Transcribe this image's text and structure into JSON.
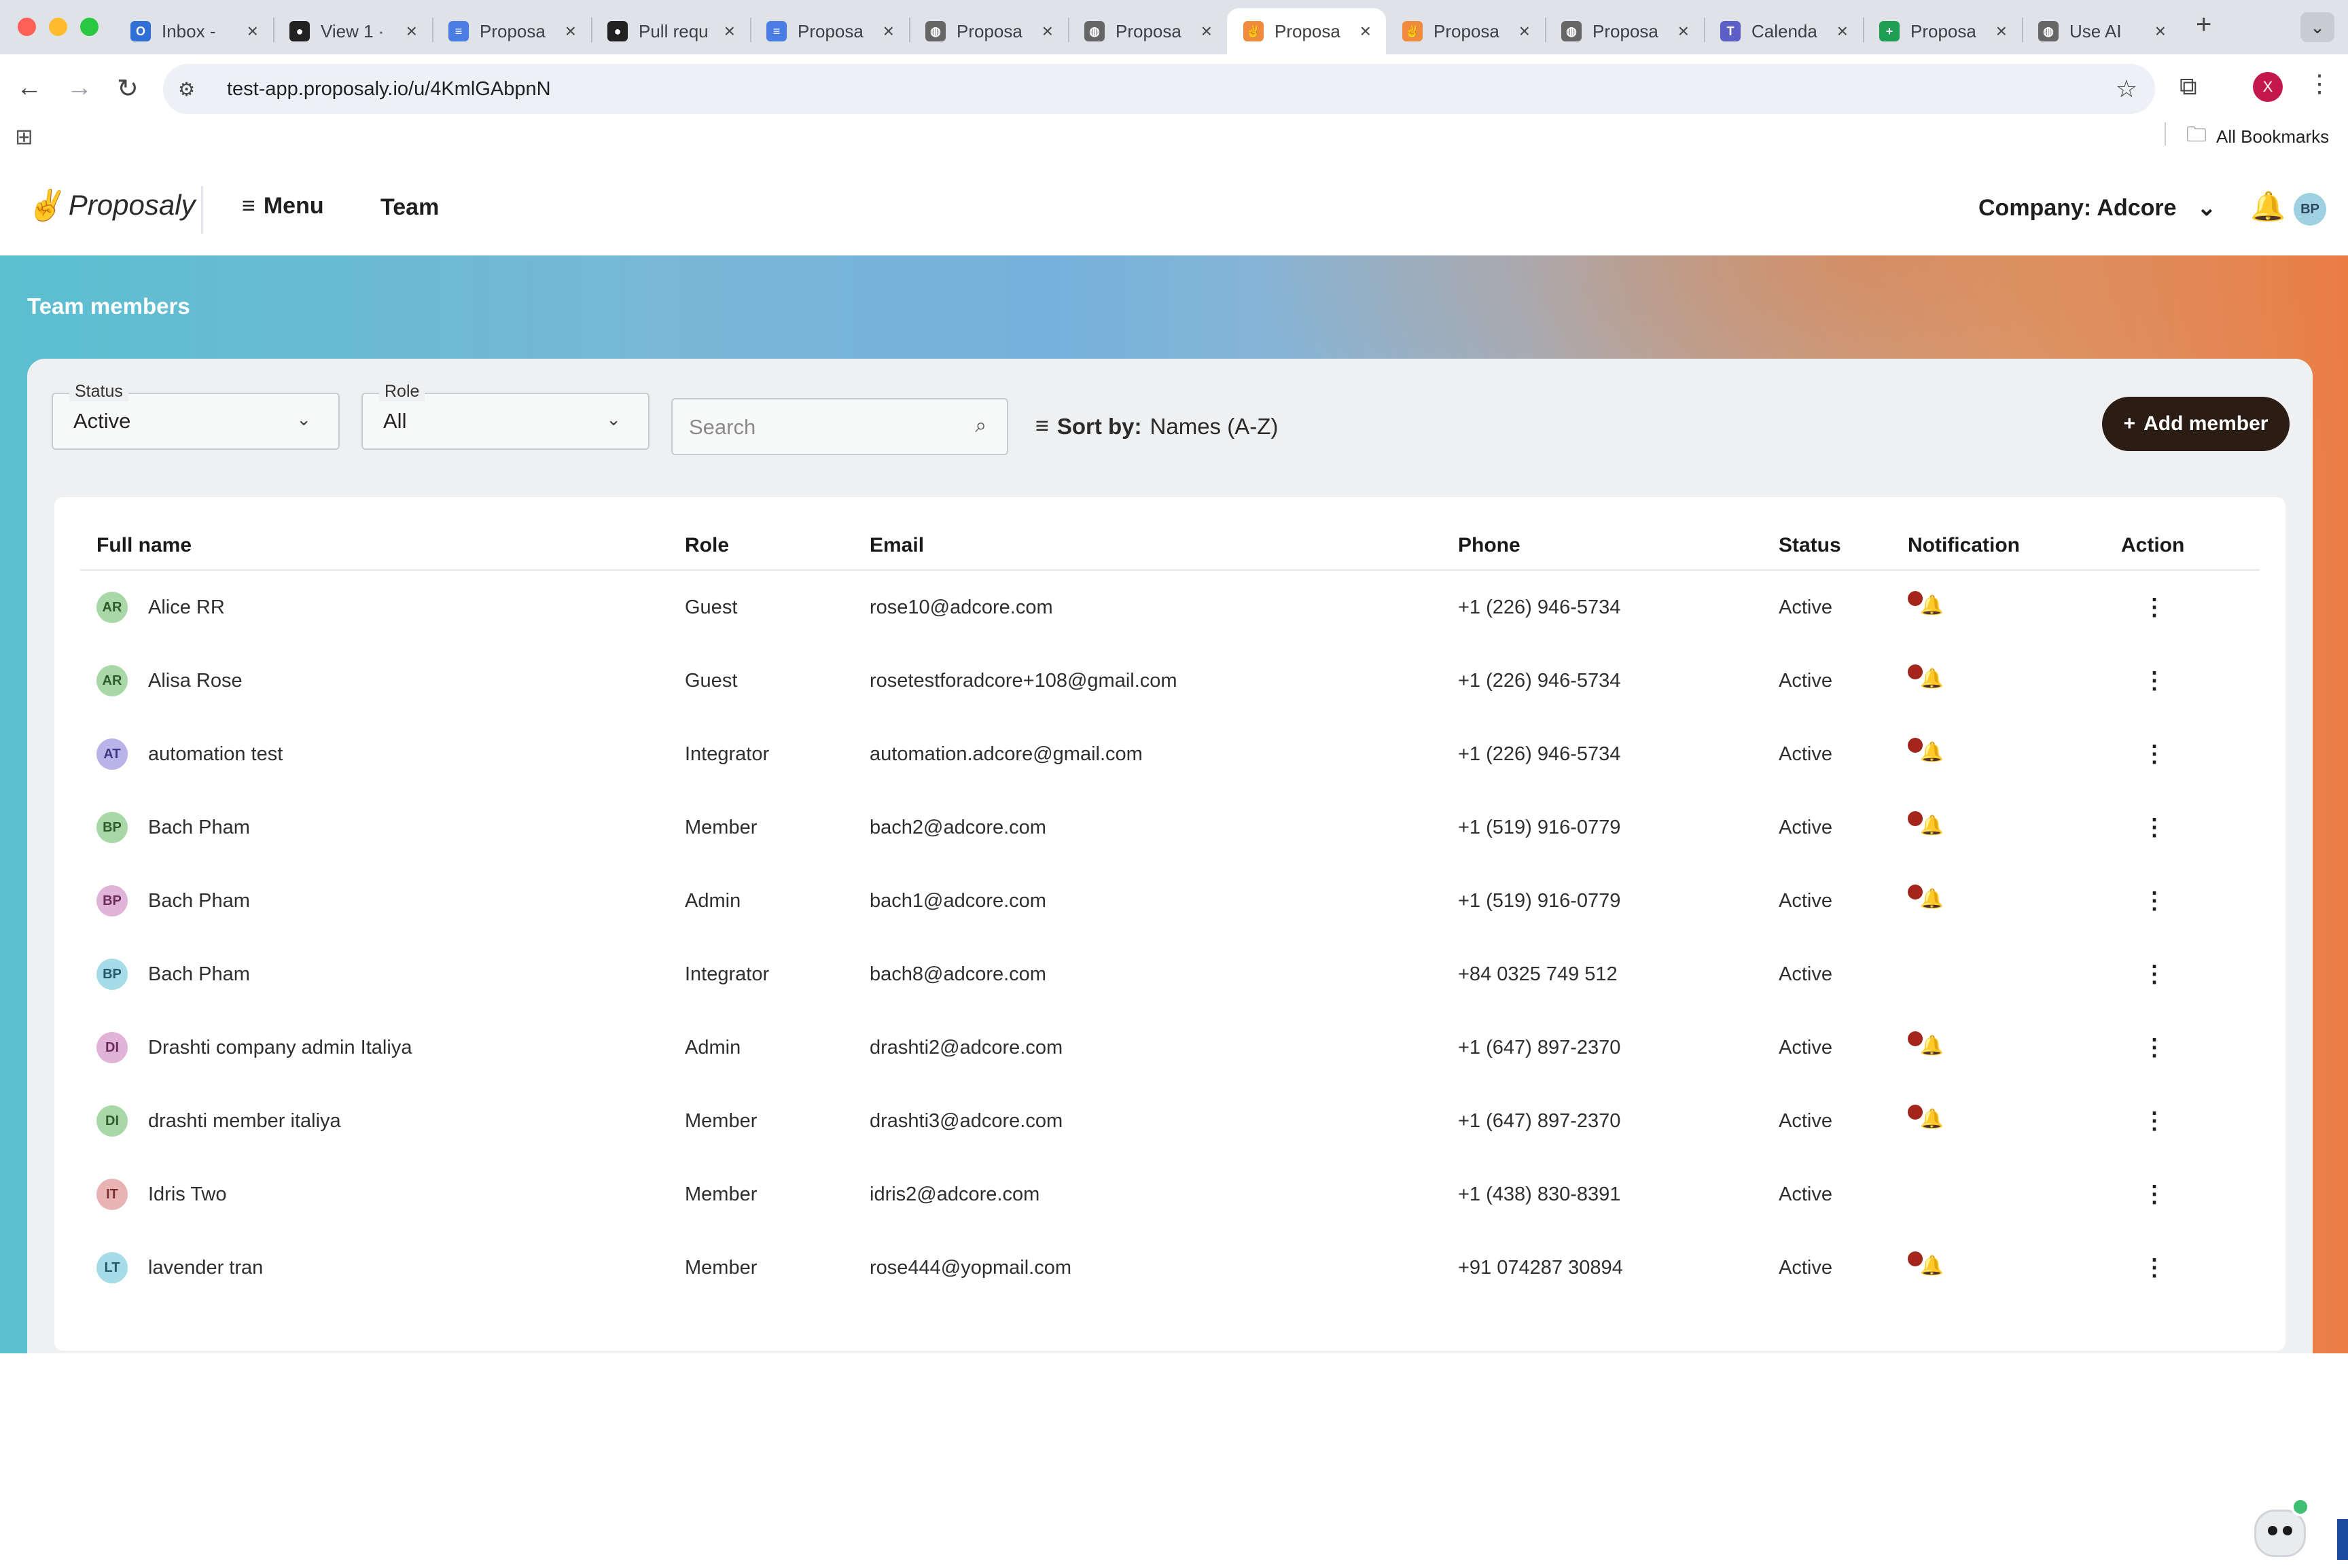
{
  "browser": {
    "tabs": [
      {
        "title": "Inbox - ",
        "icon": "outlook-icon",
        "color": "#2f6fd6"
      },
      {
        "title": "View 1 · ",
        "icon": "github-icon",
        "color": "#222222"
      },
      {
        "title": "Proposa",
        "icon": "docs-icon",
        "color": "#4a7de3"
      },
      {
        "title": "Pull requ",
        "icon": "github-icon",
        "color": "#222222"
      },
      {
        "title": "Proposa",
        "icon": "docs-icon",
        "color": "#4a7de3"
      },
      {
        "title": "Proposa",
        "icon": "globe-icon",
        "color": "#666666"
      },
      {
        "title": "Proposa",
        "icon": "globe-icon",
        "color": "#666666"
      },
      {
        "title": "Proposa",
        "icon": "proposaly-icon",
        "color": "#f08a3c"
      },
      {
        "title": "Proposa",
        "icon": "proposaly-icon",
        "color": "#f08a3c"
      },
      {
        "title": "Proposa",
        "icon": "globe-icon",
        "color": "#666666"
      },
      {
        "title": "Calenda",
        "icon": "teams-icon",
        "color": "#5b5fc7"
      },
      {
        "title": "Proposa",
        "icon": "sheets-icon",
        "color": "#1e9e55"
      },
      {
        "title": "Use AI ",
        "icon": "globe-icon",
        "color": "#666666"
      }
    ],
    "active_tab_index": 7,
    "url": "test-app.proposaly.io/u/4KmlGAbpnN",
    "profile_initial": "X",
    "bookmarks_label": "All Bookmarks"
  },
  "header": {
    "logo": "Proposaly",
    "menu_label": "Menu",
    "team_label": "Team",
    "company_label": "Company: Adcore",
    "user_initials": "BP"
  },
  "page": {
    "title": "Team members"
  },
  "filters": {
    "status": {
      "label": "Status",
      "value": "Active"
    },
    "role": {
      "label": "Role",
      "value": "All"
    },
    "search_placeholder": "Search",
    "sort_prefix": "Sort by:",
    "sort_value": "Names (A-Z)",
    "add_member_label": "Add member"
  },
  "table": {
    "columns": [
      "Full name",
      "Role",
      "Email",
      "Phone",
      "Status",
      "Notification",
      "Action"
    ],
    "rows": [
      {
        "initials": "AR",
        "avatar_bg": "#a9d8a8",
        "avatar_fg": "#2f5b2e",
        "name": "Alice RR",
        "role": "Guest",
        "email": "rose10@adcore.com",
        "phone": "+1 (226) 946-5734",
        "status": "Active",
        "notification": true
      },
      {
        "initials": "AR",
        "avatar_bg": "#a9d8a8",
        "avatar_fg": "#2f5b2e",
        "name": "Alisa Rose",
        "role": "Guest",
        "email": "rosetestforadcore+108@gmail.com",
        "phone": "+1 (226) 946-5734",
        "status": "Active",
        "notification": true
      },
      {
        "initials": "AT",
        "avatar_bg": "#b9b3ea",
        "avatar_fg": "#3d3680",
        "name": "automation test",
        "role": "Integrator",
        "email": "automation.adcore@gmail.com",
        "phone": "+1 (226) 946-5734",
        "status": "Active",
        "notification": true
      },
      {
        "initials": "BP",
        "avatar_bg": "#a9d8a8",
        "avatar_fg": "#2f5b2e",
        "name": "Bach Pham",
        "role": "Member",
        "email": "bach2@adcore.com",
        "phone": "+1 (519) 916-0779",
        "status": "Active",
        "notification": true
      },
      {
        "initials": "BP",
        "avatar_bg": "#e2b3d8",
        "avatar_fg": "#6b2d5e",
        "name": "Bach Pham",
        "role": "Admin",
        "email": "bach1@adcore.com",
        "phone": "+1 (519) 916-0779",
        "status": "Active",
        "notification": true
      },
      {
        "initials": "BP",
        "avatar_bg": "#a6dbe8",
        "avatar_fg": "#23596a",
        "name": "Bach Pham",
        "role": "Integrator",
        "email": "bach8@adcore.com",
        "phone": "+84 0325 749 512",
        "status": "Active",
        "notification": false
      },
      {
        "initials": "DI",
        "avatar_bg": "#e2b3d8",
        "avatar_fg": "#6b2d5e",
        "name": "Drashti company admin Italiya",
        "role": "Admin",
        "email": "drashti2@adcore.com",
        "phone": "+1 (647) 897-2370",
        "status": "Active",
        "notification": true
      },
      {
        "initials": "DI",
        "avatar_bg": "#a9d8a8",
        "avatar_fg": "#2f5b2e",
        "name": "drashti member italiya",
        "role": "Member",
        "email": "drashti3@adcore.com",
        "phone": "+1 (647) 897-2370",
        "status": "Active",
        "notification": true
      },
      {
        "initials": "IT",
        "avatar_bg": "#eab3b3",
        "avatar_fg": "#7a2e2e",
        "name": "Idris Two",
        "role": "Member",
        "email": "idris2@adcore.com",
        "phone": "+1 (438) 830-8391",
        "status": "Active",
        "notification": false
      },
      {
        "initials": "LT",
        "avatar_bg": "#a6dbe8",
        "avatar_fg": "#23596a",
        "name": "lavender tran",
        "role": "Member",
        "email": "rose444@yopmail.com",
        "phone": "+91 074287 30894",
        "status": "Active",
        "notification": true
      }
    ]
  },
  "colors": {
    "notification_dot": "#a3251c",
    "add_button_bg": "#2b1d14"
  }
}
